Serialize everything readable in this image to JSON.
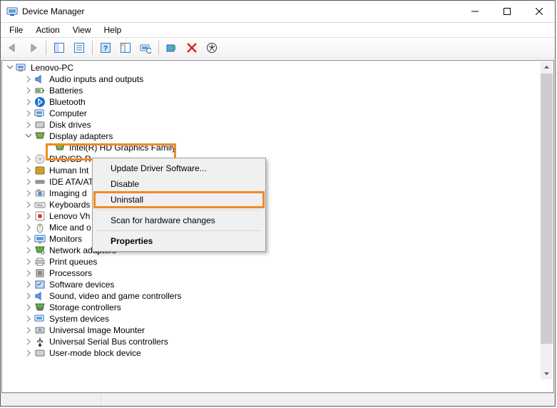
{
  "window": {
    "title": "Device Manager"
  },
  "menu": {
    "file": "File",
    "action": "Action",
    "view": "View",
    "help": "Help"
  },
  "tree": {
    "root": "Lenovo-PC",
    "items": [
      "Audio inputs and outputs",
      "Batteries",
      "Bluetooth",
      "Computer",
      "Disk drives",
      "Display adapters",
      "Intel(R) HD Graphics Family",
      "DVD/CD-R",
      "Human Int",
      "IDE ATA/AT",
      "Imaging d",
      "Keyboards",
      "Lenovo Vh",
      "Mice and o",
      "Monitors",
      "Network adapters",
      "Print queues",
      "Processors",
      "Software devices",
      "Sound, video and game controllers",
      "Storage controllers",
      "System devices",
      "Universal Image Mounter",
      "Universal Serial Bus controllers",
      "User-mode block device"
    ]
  },
  "context_menu": {
    "update": "Update Driver Software...",
    "disable": "Disable",
    "uninstall": "Uninstall",
    "scan": "Scan for hardware changes",
    "properties": "Properties"
  }
}
